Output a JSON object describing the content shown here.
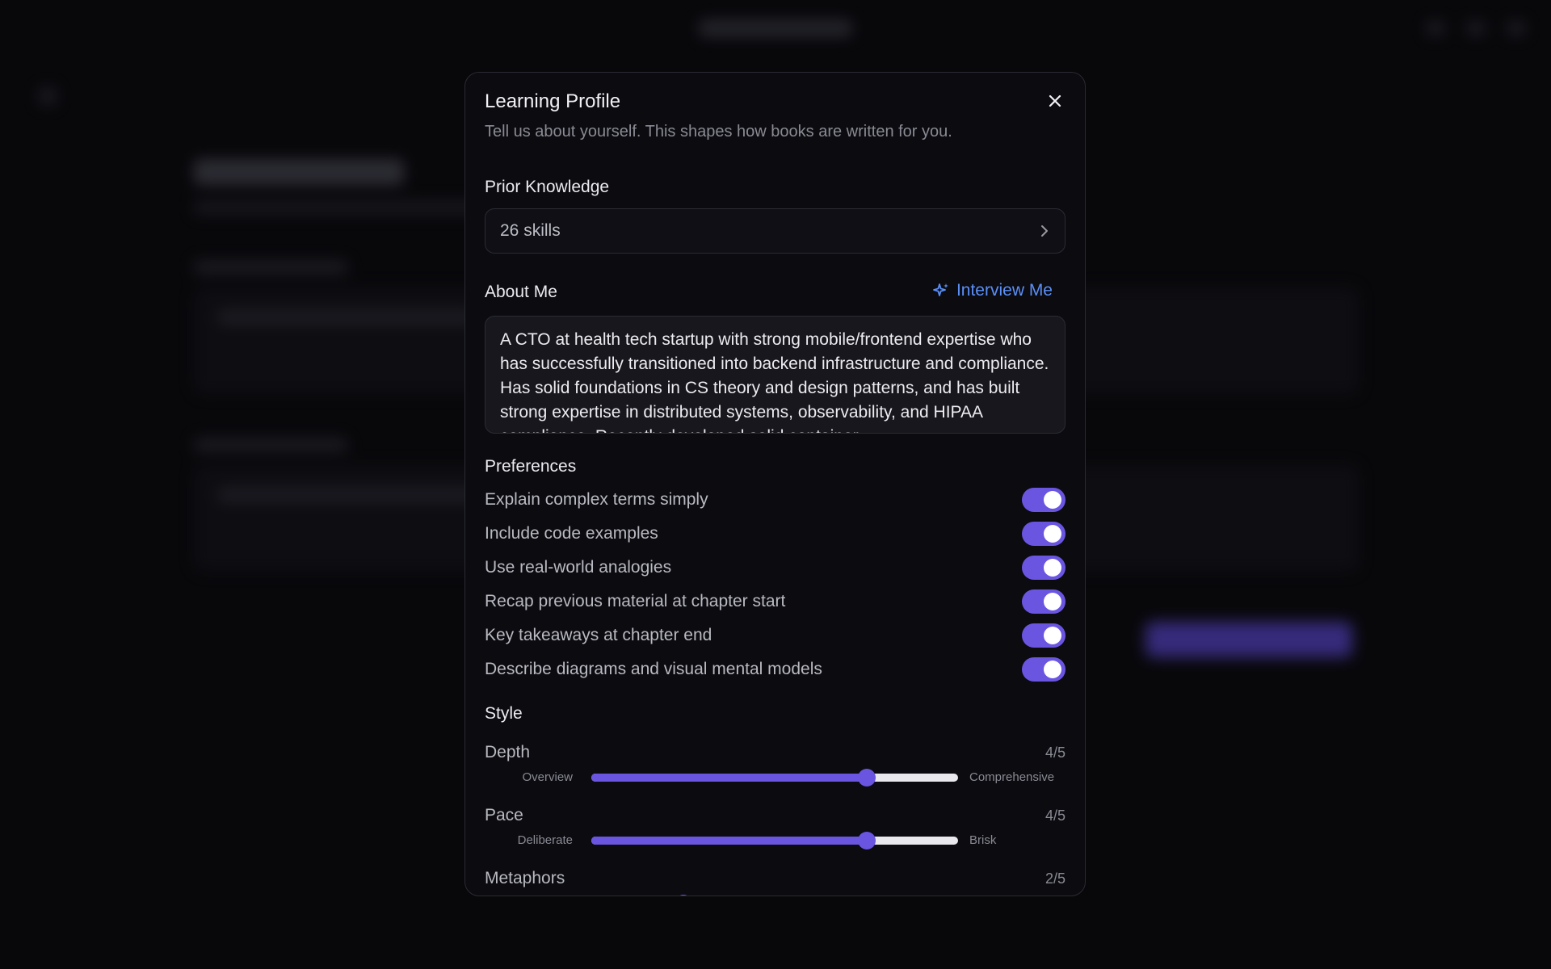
{
  "modal": {
    "title": "Learning Profile",
    "subtitle": "Tell us about yourself. This shapes how books are written for you.",
    "close_icon": "close-icon"
  },
  "prior_knowledge": {
    "label": "Prior Knowledge",
    "value": "26 skills",
    "icon": "chevron-right-icon"
  },
  "about_me": {
    "label": "About Me",
    "interview_label": "Interview Me",
    "interview_icon": "sparkle-icon",
    "text": "A CTO at health tech startup with strong mobile/frontend expertise who has successfully transitioned into backend infrastructure and compliance. Has solid foundations in CS theory and design patterns, and has built strong expertise in distributed systems, observability, and HIPAA compliance. Recently developed solid container"
  },
  "preferences": {
    "label": "Preferences",
    "items": [
      {
        "label": "Explain complex terms simply",
        "on": true
      },
      {
        "label": "Include code examples",
        "on": true
      },
      {
        "label": "Use real-world analogies",
        "on": true
      },
      {
        "label": "Recap previous material at chapter start",
        "on": true
      },
      {
        "label": "Key takeaways at chapter end",
        "on": true
      },
      {
        "label": "Describe diagrams and visual mental models",
        "on": true
      }
    ]
  },
  "style": {
    "label": "Style",
    "sliders": [
      {
        "name": "Depth",
        "value_text": "4/5",
        "value": 4,
        "max": 5,
        "min_label": "Overview",
        "max_label": "Comprehensive"
      },
      {
        "name": "Pace",
        "value_text": "4/5",
        "value": 4,
        "max": 5,
        "min_label": "Deliberate",
        "max_label": "Brisk"
      },
      {
        "name": "Metaphors",
        "value_text": "2/5",
        "value": 2,
        "max": 5,
        "min_label": "",
        "max_label": ""
      }
    ]
  },
  "colors": {
    "accent": "#6a55e0",
    "link": "#5b8ff6",
    "modal_bg": "#0b0b10"
  }
}
